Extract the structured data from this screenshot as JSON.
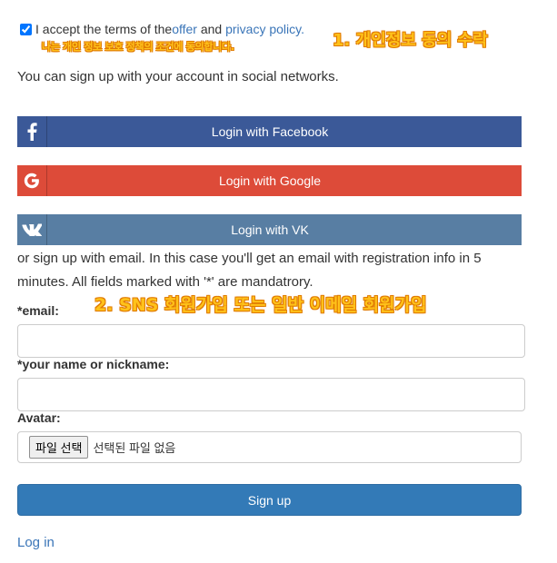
{
  "terms": {
    "checked": true,
    "prefix": "I accept the terms of the ",
    "offer_link": "offer",
    "middle": " and ",
    "privacy_link": "privacy policy."
  },
  "annotations": {
    "terms_subnote": "나는 개인 정보 보호 정책의 조건에 동의합니다.",
    "step1": "1. 개인정보 동의 수락",
    "step2": "2. SNS 회원가입 또는 일반 이메일 회원가입"
  },
  "social": {
    "intro": "You can sign up with your account in social networks.",
    "buttons": [
      {
        "label": "Login with Facebook",
        "icon": "facebook-icon",
        "color": "#3b5998"
      },
      {
        "label": "Login with Google",
        "icon": "google-icon",
        "color": "#dd4b39"
      },
      {
        "label": "Login with VK",
        "icon": "vk-icon",
        "color": "#587ea3"
      }
    ]
  },
  "email_signup": {
    "intro": "or sign up with email. In this case you'll get an email with registration info in 5 minutes. All fields marked with '*' are mandatrory.",
    "email_label": "*email:",
    "email_value": "",
    "name_label": "*your name or nickname:",
    "name_value": "",
    "avatar_label": "Avatar:",
    "file_button": "파일 선택",
    "file_status": "선택된 파일 없음",
    "submit_label": "Sign up"
  },
  "footer": {
    "login_link": "Log in"
  },
  "colors": {
    "link": "#3a75b8",
    "primary": "#337ab7",
    "annotation": "#ffc21a"
  }
}
